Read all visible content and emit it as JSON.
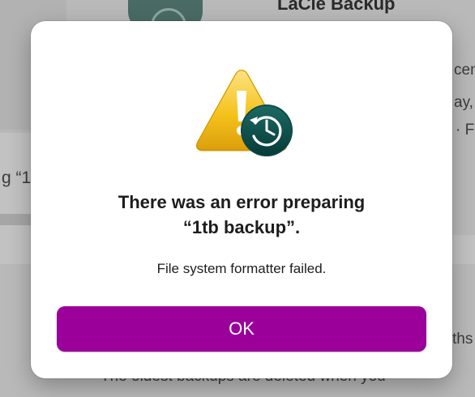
{
  "background": {
    "window_title": "LaCie Backup",
    "partial_texts": {
      "right_1": "cen",
      "right_2": "ay,",
      "right_3": "· F",
      "left_fragment": "g “1",
      "right_4": "ths",
      "bottom": "The oldest backups are deleted when you"
    }
  },
  "alert": {
    "icon": "warning-triangle-with-time-machine-icon",
    "title_line1": "There was an error preparing",
    "title_line2": "“1tb backup”.",
    "message": "File system formatter failed.",
    "ok_label": "OK"
  },
  "colors": {
    "button_accent": "#9b009b",
    "warning_yellow": "#f5c21b",
    "time_machine_green": "#0d4f4c"
  }
}
